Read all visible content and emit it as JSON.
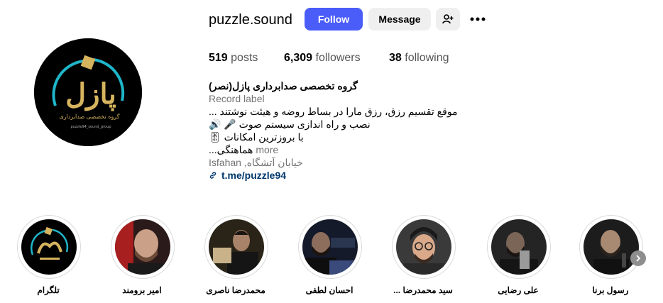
{
  "profile": {
    "username": "puzzle.sound",
    "logo_text": "پازل",
    "logo_sub": "گروه تخصصی صدابرداری",
    "logo_handle": "puzzle94_sound_group"
  },
  "actions": {
    "follow_label": "Follow",
    "message_label": "Message",
    "add_user_icon": "person-plus-icon",
    "more_icon": "ellipsis-icon"
  },
  "stats": {
    "posts_count": "519",
    "posts_label": "posts",
    "followers_count": "6,309",
    "followers_label": "followers",
    "following_count": "38",
    "following_label": "following"
  },
  "bio": {
    "name": "گروه تخصصی صدابرداری پازل(نصر)",
    "category": "Record label",
    "line1": "موقع تقسیم رزق، رزق مارا در بساط روضه و هیئت نوشتند ...",
    "line2": "نصب و راه اندازی سیستم صوت 🎤 🔊",
    "line3": "با بروزترین امکانات 🎚",
    "line4": "هماهنگی...",
    "more_label": "more",
    "location": "Isfahan ,خیابان آتشگاه",
    "link": "t.me/puzzle94"
  },
  "highlights": [
    {
      "label": "رسول برنا"
    },
    {
      "label": "علی رضایی"
    },
    {
      "label": "سید محمدرضا ..."
    },
    {
      "label": "احسان لطفی"
    },
    {
      "label": "محمدرضا ناصری"
    },
    {
      "label": "امیر برومند"
    },
    {
      "label": "تلگرام"
    }
  ],
  "colors": {
    "accent": "#4a5df9",
    "link": "#00376b",
    "logo_gold": "#d6b35e",
    "logo_teal": "#1fb5c9"
  }
}
